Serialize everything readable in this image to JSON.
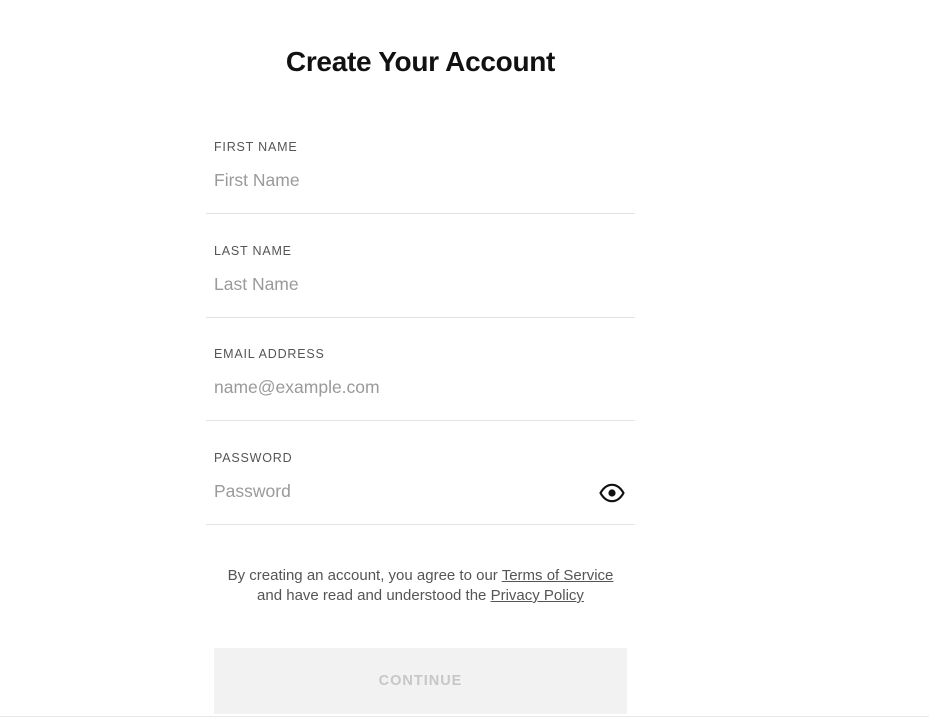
{
  "page_title": "Create Your Account",
  "fields": [
    {
      "label": "FIRST NAME",
      "placeholder": "First Name",
      "value": ""
    },
    {
      "label": "LAST NAME",
      "placeholder": "Last Name",
      "value": ""
    },
    {
      "label": "EMAIL ADDRESS",
      "placeholder": "name@example.com",
      "value": ""
    },
    {
      "label": "PASSWORD",
      "placeholder": "Password",
      "value": ""
    }
  ],
  "password_toggle_icon": "eye-icon",
  "legal": {
    "line1_text": "By creating an account, you agree to our ",
    "terms_link": "Terms of Service",
    "line2_text": "and have read and understood the ",
    "privacy_link": "Privacy Policy"
  },
  "continue_label": "CONTINUE",
  "colors": {
    "title": "#111111",
    "label": "#555555",
    "placeholder": "#9a9a9a",
    "divider": "#e2e2e2",
    "button_bg": "#f2f2f2",
    "button_text_disabled": "#c7c7c7"
  }
}
